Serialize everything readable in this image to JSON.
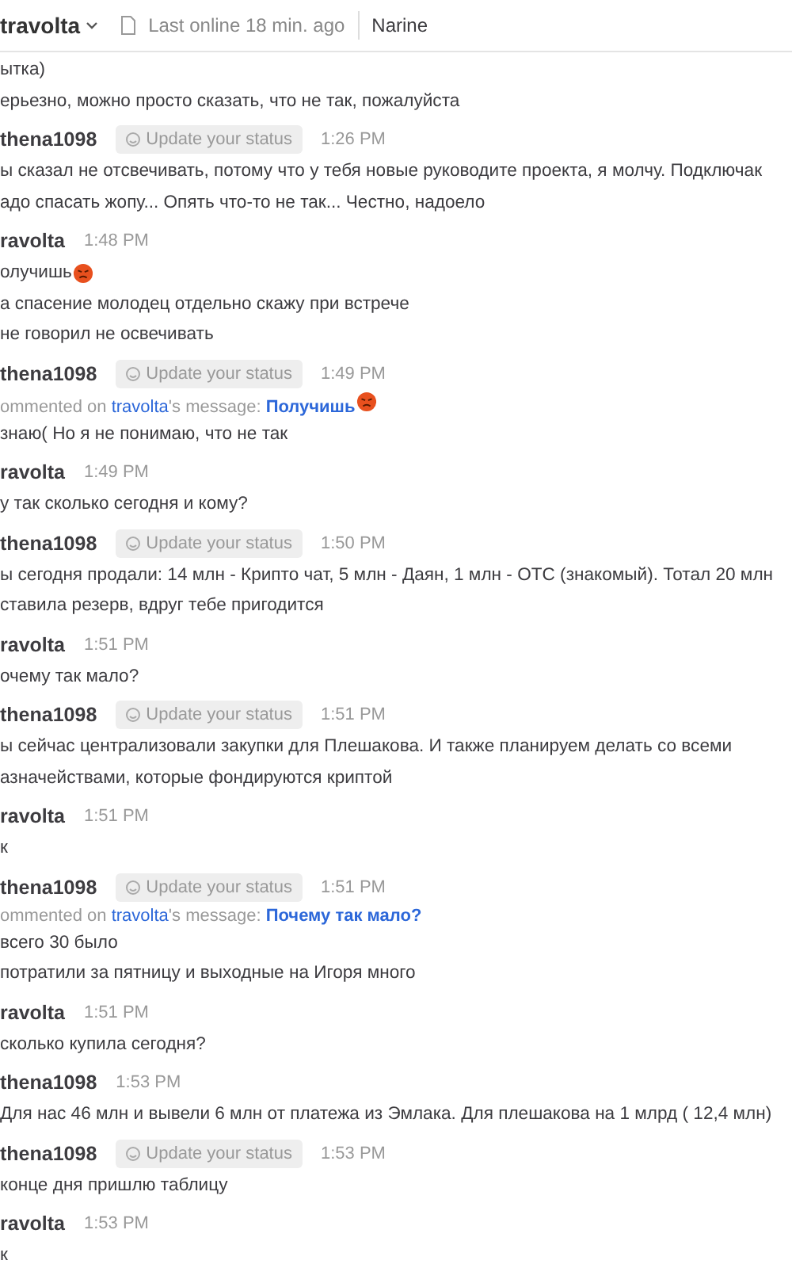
{
  "header": {
    "title": "travolta",
    "last_online": "Last online 18 min. ago",
    "member": "Narine"
  },
  "messages": [
    {
      "lines": [
        {
          "text": "ытка)"
        },
        {
          "text": "ерьезно, можно просто сказать, что не так, пожалуйста"
        }
      ]
    },
    {
      "author": "thena1098",
      "status": "Update your status",
      "time": "1:26 PM",
      "lines": [
        {
          "text": "ы сказал не отсвечивать, потому что у тебя новые руководите проекта, я молчу. Подключак"
        },
        {
          "text": "адо спасать жопу... Опять что-то не так... Честно, надоело"
        }
      ]
    },
    {
      "author": "ravolta",
      "time": "1:48 PM",
      "lines": [
        {
          "text": "олучишь",
          "emoji": true
        },
        {
          "text": "а спасение молодец отдельно скажу при встрече"
        },
        {
          "text": "не говорил не освечивать"
        }
      ]
    },
    {
      "author": "thena1098",
      "status": "Update your status",
      "time": "1:49 PM",
      "comment": {
        "prefix": "ommented on",
        "user": "travolta",
        "mid": "'s message:",
        "quote": "Получишь",
        "emoji": true
      },
      "lines": [
        {
          "text": "знаю( Но я не понимаю, что не так"
        }
      ]
    },
    {
      "author": "ravolta",
      "time": "1:49 PM",
      "lines": [
        {
          "text": "у так сколько сегодня и кому?"
        }
      ]
    },
    {
      "author": "thena1098",
      "status": "Update your status",
      "time": "1:50 PM",
      "lines": [
        {
          "text": "ы сегодня продали: 14 млн - Крипто чат, 5 млн - Даян, 1 млн - OTC (знакомый). Тотал 20 млн"
        },
        {
          "text": "ставила резерв, вдруг тебе пригодится"
        }
      ]
    },
    {
      "author": "ravolta",
      "time": "1:51 PM",
      "lines": [
        {
          "text": "очему так мало?"
        }
      ]
    },
    {
      "author": "thena1098",
      "status": "Update your status",
      "time": "1:51 PM",
      "lines": [
        {
          "text": "ы сейчас централизовали закупки для Плешакова. И также планируем делать со всеми"
        },
        {
          "text": "азначействами, которые фондируются криптой"
        }
      ]
    },
    {
      "author": "ravolta",
      "time": "1:51 PM",
      "lines": [
        {
          "text": "к"
        }
      ]
    },
    {
      "author": "thena1098",
      "status": "Update your status",
      "time": "1:51 PM",
      "comment": {
        "prefix": "ommented on",
        "user": "travolta",
        "mid": "'s message:",
        "quote": "Почему так мало?"
      },
      "lines": [
        {
          "text": "всего 30 было"
        },
        {
          "text": "потратили за пятницу и выходные на Игоря много"
        }
      ]
    },
    {
      "author": "ravolta",
      "time": "1:51 PM",
      "lines": [
        {
          "text": "сколько купила сегодня?"
        }
      ]
    },
    {
      "author": "thena1098",
      "time": "1:53 PM",
      "lines": [
        {
          "text": "Для нас 46 млн и вывели 6 млн от платежа из Эмлака. Для плешакова на 1 млрд ( 12,4 млн)"
        }
      ]
    },
    {
      "author": "thena1098",
      "status": "Update your status",
      "time": "1:53 PM",
      "lines": [
        {
          "text": "конце дня пришлю таблицу"
        }
      ]
    },
    {
      "author": "ravolta",
      "time": "1:53 PM",
      "lines": [
        {
          "text": "к"
        }
      ]
    }
  ]
}
